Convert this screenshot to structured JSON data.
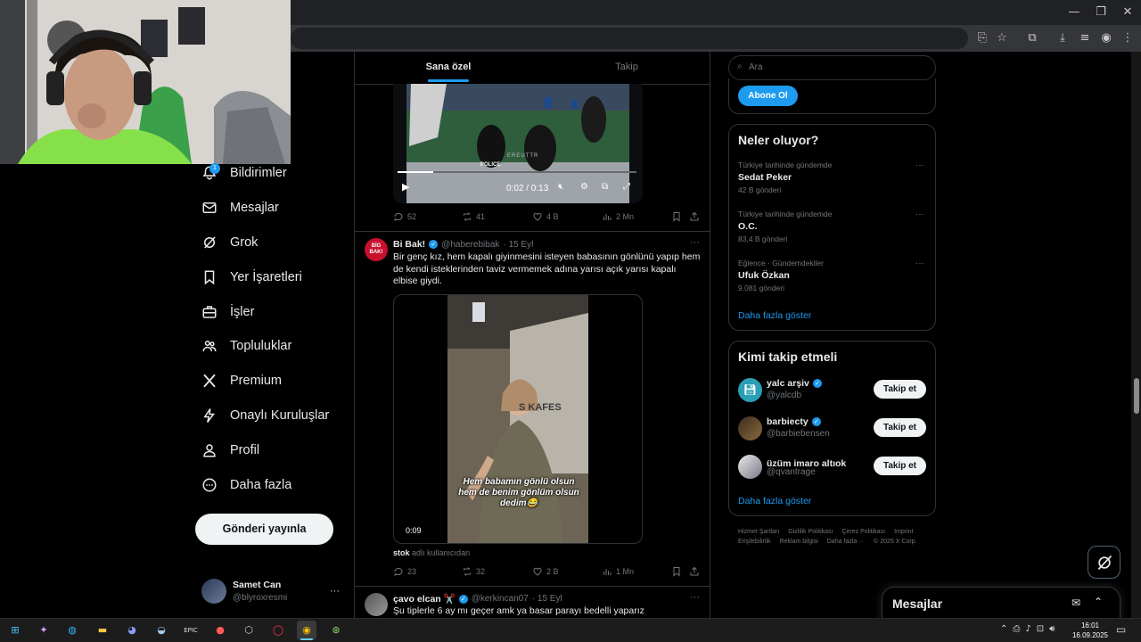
{
  "browser": {
    "window_controls": {
      "minimize": "—",
      "restore": "❐",
      "close": "✕"
    }
  },
  "nav": {
    "badge_count": "1",
    "items": [
      {
        "label": "Bildirimler",
        "icon": "bell-icon"
      },
      {
        "label": "Mesajlar",
        "icon": "mail-icon"
      },
      {
        "label": "Grok",
        "icon": "grok-icon"
      },
      {
        "label": "Yer İşaretleri",
        "icon": "bookmark-icon"
      },
      {
        "label": "İşler",
        "icon": "briefcase-icon"
      },
      {
        "label": "Topluluklar",
        "icon": "people-icon"
      },
      {
        "label": "Premium",
        "icon": "x-logo-icon"
      },
      {
        "label": "Onaylı Kuruluşlar",
        "icon": "lightning-icon"
      },
      {
        "label": "Profil",
        "icon": "person-icon"
      },
      {
        "label": "Daha fazla",
        "icon": "more-circle-icon"
      }
    ],
    "post_button": "Gönderi yayınla",
    "account": {
      "name": "Samet Can",
      "handle": "@blyroxresmi",
      "more": "···"
    }
  },
  "feed": {
    "tabs": [
      "Sana özel",
      "Takip"
    ],
    "video1": {
      "time": "0:02 / 0:13",
      "watermark": "EREUTTR",
      "police_label": "POLICE",
      "progress": 0.15
    },
    "post1_actions": {
      "replies": "52",
      "reposts": "41",
      "likes": "4 B",
      "views": "2 Mn"
    },
    "post2": {
      "avatar_text": "BİG BAK!",
      "name": "Bi Bak!",
      "handle": "@haberebibak",
      "date": "· 15 Eyl",
      "text": "Bir genç kız, hem kapalı giyinmesini isteyen babasının gönlünü yapıp hem de kendi isteklerinden taviz vermemek adına yarısı açık yarısı kapalı elbise giydi.",
      "video_caption": "Hem babamın gönlü olsun hem de benim gönlüm olsun dedim😂",
      "video_sign": "S   KAFES",
      "video_time": "0:09",
      "stock_user": "stok",
      "stock_text": "adlı kullanıcıdan",
      "actions": {
        "replies": "23",
        "reposts": "32",
        "likes": "2 B",
        "views": "1 Mn"
      },
      "more": "···"
    },
    "post3": {
      "name": "çavo elcan ✂️",
      "handle": "@kerkincan07",
      "date": "· 15 Eyl",
      "text": "Şu tiplerle 6 ay mı geçer amk ya basar parayı bedelli yaparız",
      "more": "···"
    }
  },
  "sidebar": {
    "search_placeholder": "Ara",
    "subscribe_button": "Abone Ol",
    "trends": {
      "title": "Neler oluyor?",
      "items": [
        {
          "category": "Türkiye tarihinde gündemde",
          "name": "Sedat Peker",
          "count": "42 B gönderi"
        },
        {
          "category": "Türkiye tarihinde gündemde",
          "name": "O.C.",
          "count": "83,4 B gönderi"
        },
        {
          "category": "Eğlence · Gündemdekiler",
          "name": "Ufuk Özkan",
          "count": "9.081 gönderi"
        }
      ],
      "show_more": "Daha fazla göster",
      "more": "···"
    },
    "who_to_follow": {
      "title": "Kimi takip etmeli",
      "items": [
        {
          "name": "yalc arşiv",
          "handle": "@yalcdb",
          "button": "Takip et"
        },
        {
          "name": "barbiecty",
          "handle": "@barbiebensen",
          "button": "Takip et"
        },
        {
          "name": "üzüm imaro altıok",
          "handle": "@qvantrage",
          "button": "Takip et"
        }
      ],
      "show_more": "Daha fazla göster"
    },
    "footer": {
      "links": [
        "Hizmet Şartları",
        "Gizlilik Politikası",
        "Çerez Politikası",
        "Imprint",
        "Erişilebilirlik",
        "Reklam bilgisi",
        "Daha fazla ···"
      ],
      "copyright": "© 2025 X Corp."
    }
  },
  "messages_drawer": {
    "title": "Mesajlar"
  },
  "taskbar": {
    "time": "16:01",
    "date": "16.09.2025"
  }
}
